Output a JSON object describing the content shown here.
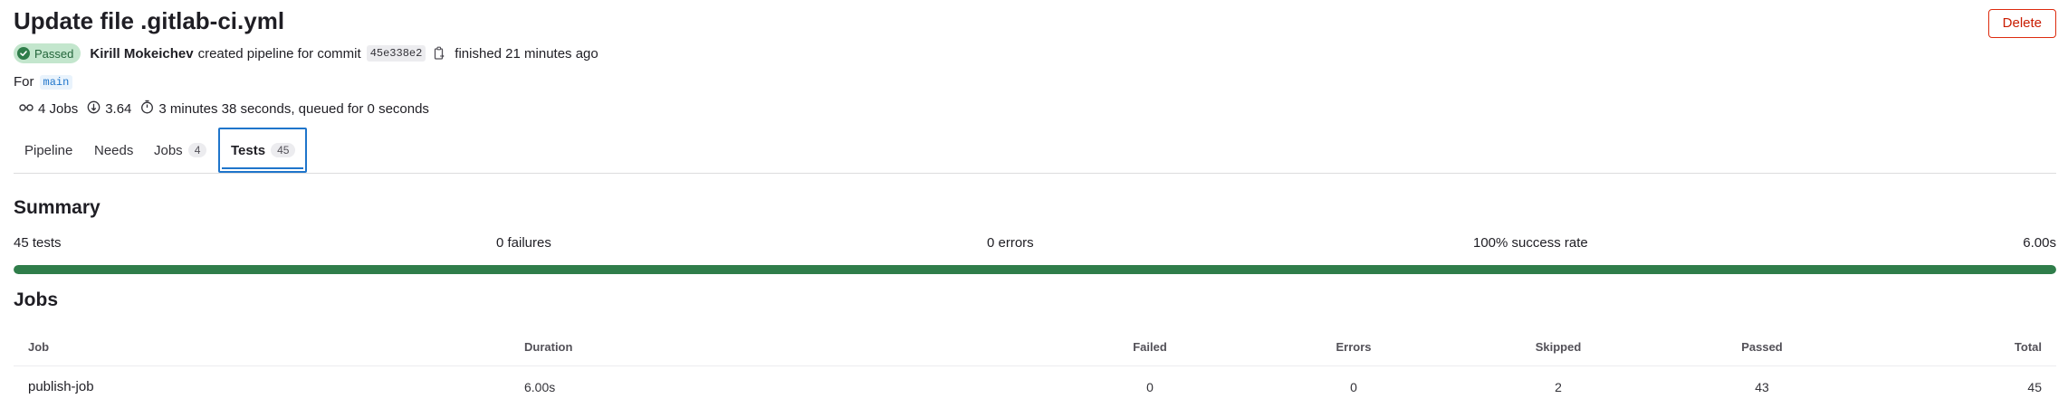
{
  "header": {
    "title": "Update file .gitlab-ci.yml",
    "delete_label": "Delete",
    "status_label": "Passed",
    "author": "Kirill Mokeichev",
    "created_text": "created pipeline for commit",
    "commit_sha": "45e338e2",
    "finished_text": "finished 21 minutes ago",
    "for_label": "For",
    "branch": "main",
    "jobs_count_text": "4 Jobs",
    "compute_value": "3.64",
    "duration_text": "3 minutes 38 seconds, queued for 0 seconds"
  },
  "tabs": [
    {
      "label": "Pipeline",
      "count": ""
    },
    {
      "label": "Needs",
      "count": ""
    },
    {
      "label": "Jobs",
      "count": "4"
    },
    {
      "label": "Tests",
      "count": "45"
    }
  ],
  "summary": {
    "heading": "Summary",
    "tests": "45 tests",
    "failures": "0 failures",
    "errors": "0 errors",
    "success_rate": "100% success rate",
    "time": "6.00s",
    "progress_fraction": 1.0
  },
  "jobs_table": {
    "heading": "Jobs",
    "columns": [
      "Job",
      "Duration",
      "Failed",
      "Errors",
      "Skipped",
      "Passed",
      "Total"
    ],
    "rows": [
      [
        "publish-job",
        "6.00s",
        "0",
        "0",
        "2",
        "43",
        "45"
      ]
    ]
  },
  "colors": {
    "success": "#2f7d4a",
    "danger": "#dd2b0e",
    "link": "#1f75cb"
  }
}
